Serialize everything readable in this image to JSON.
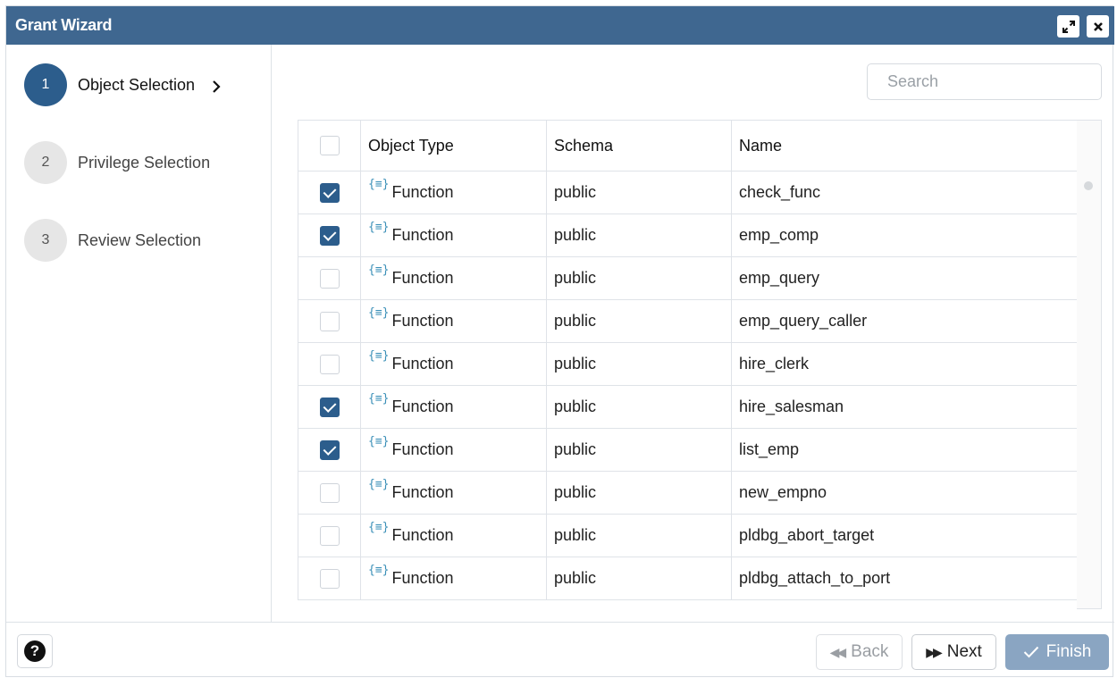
{
  "window": {
    "title": "Grant Wizard"
  },
  "titlebar": {
    "maximize_icon": "expand-icon",
    "close_icon": "close-icon"
  },
  "steps": [
    {
      "number": "1",
      "label": "Object Selection",
      "state": "active"
    },
    {
      "number": "2",
      "label": "Privilege Selection",
      "state": "inactive"
    },
    {
      "number": "3",
      "label": "Review Selection",
      "state": "inactive"
    }
  ],
  "search": {
    "placeholder": "Search",
    "value": ""
  },
  "table": {
    "headers": {
      "object_type": "Object Type",
      "schema": "Schema",
      "name": "Name"
    },
    "header_checked": false,
    "rows": [
      {
        "checked": true,
        "object_type": "Function",
        "schema": "public",
        "name": "check_func"
      },
      {
        "checked": true,
        "object_type": "Function",
        "schema": "public",
        "name": "emp_comp"
      },
      {
        "checked": false,
        "object_type": "Function",
        "schema": "public",
        "name": "emp_query"
      },
      {
        "checked": false,
        "object_type": "Function",
        "schema": "public",
        "name": "emp_query_caller"
      },
      {
        "checked": false,
        "object_type": "Function",
        "schema": "public",
        "name": "hire_clerk"
      },
      {
        "checked": true,
        "object_type": "Function",
        "schema": "public",
        "name": "hire_salesman"
      },
      {
        "checked": true,
        "object_type": "Function",
        "schema": "public",
        "name": "list_emp"
      },
      {
        "checked": false,
        "object_type": "Function",
        "schema": "public",
        "name": "new_empno"
      },
      {
        "checked": false,
        "object_type": "Function",
        "schema": "public",
        "name": "pldbg_abort_target"
      },
      {
        "checked": false,
        "object_type": "Function",
        "schema": "public",
        "name": "pldbg_attach_to_port"
      }
    ]
  },
  "footer": {
    "back_label": "Back",
    "next_label": "Next",
    "finish_label": "Finish"
  },
  "colors": {
    "titlebar": "#3f6790",
    "accent": "#2c5d8c",
    "finish_disabled": "#8aa5c2",
    "function_icon": "#3a8fb7"
  }
}
